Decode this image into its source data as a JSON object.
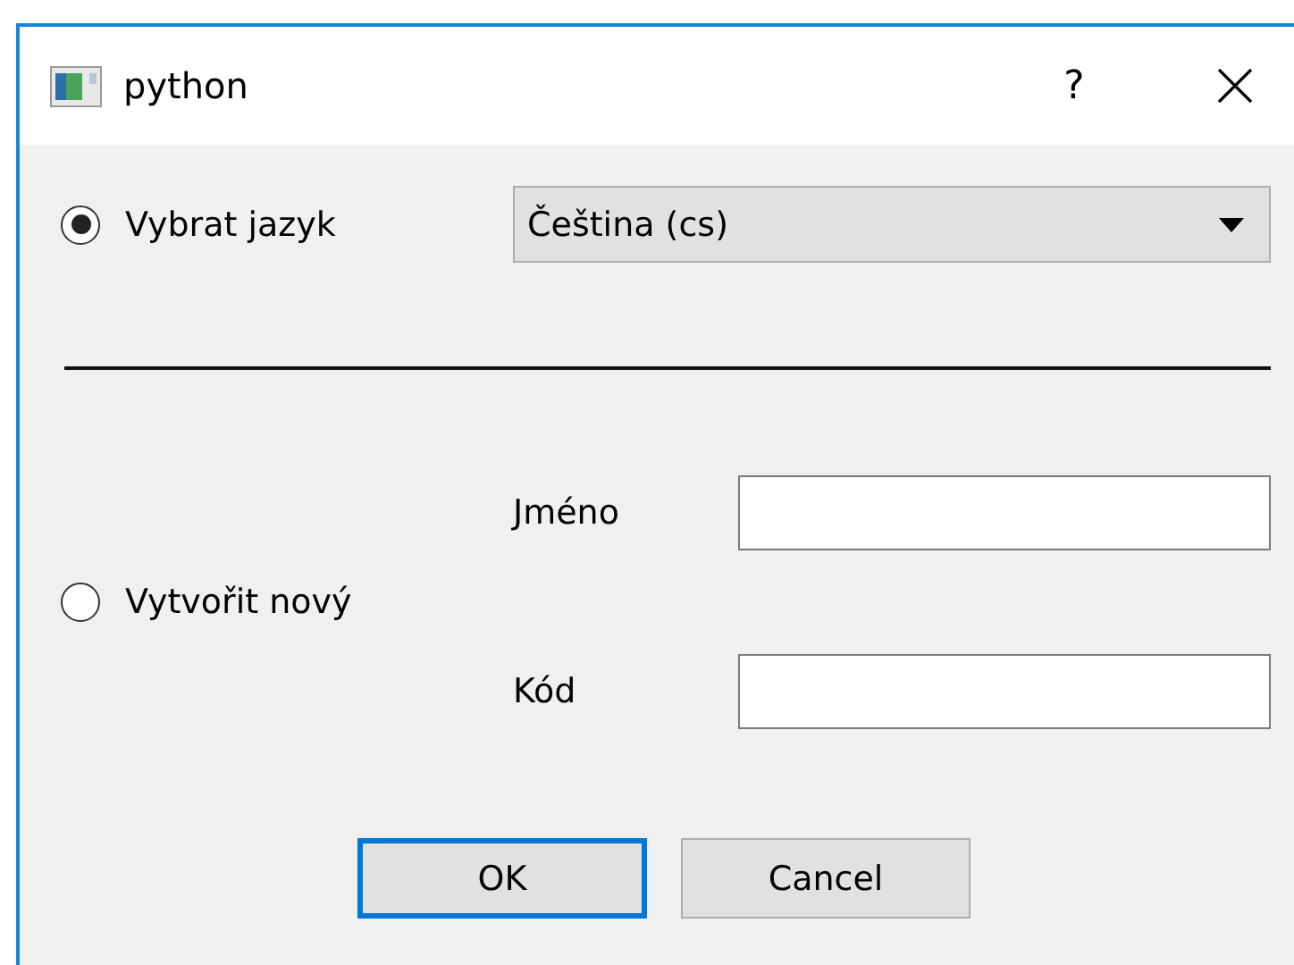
{
  "window": {
    "title": "python",
    "help": "?"
  },
  "language_option": {
    "label": "Vybrat jazyk",
    "selected": true
  },
  "language_select": {
    "value": "Čeština (cs)"
  },
  "new_option": {
    "label": "Vytvořit nový",
    "selected": false
  },
  "fields": [
    {
      "label": "Jméno"
    },
    {
      "label": "Kód"
    }
  ],
  "buttons": [
    {
      "label": "OK",
      "focused": true
    },
    {
      "label": "Cancel",
      "focused": false
    }
  ]
}
